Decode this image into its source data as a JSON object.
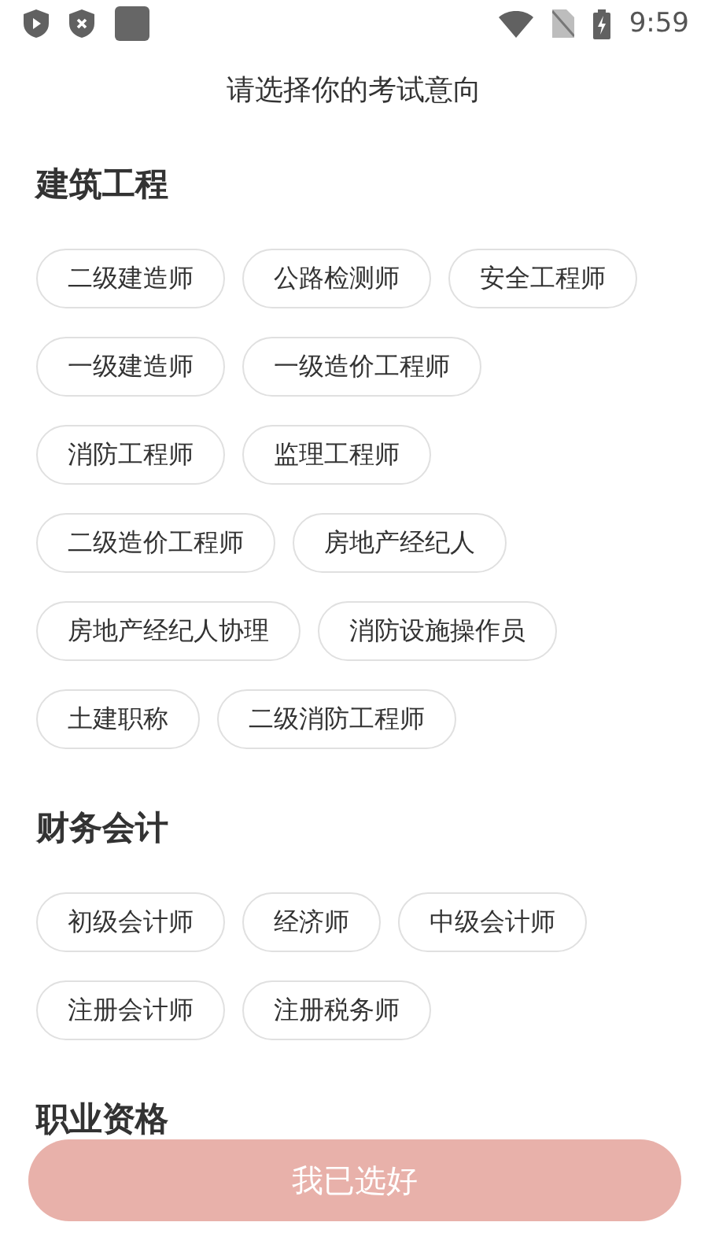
{
  "status_bar": {
    "time": "9:59"
  },
  "header": {
    "title": "请选择你的考试意向"
  },
  "sections": [
    {
      "title": "建筑工程",
      "options": [
        {
          "label": "二级建造师",
          "selected": false
        },
        {
          "label": "公路检测师",
          "selected": false
        },
        {
          "label": "安全工程师",
          "selected": false
        },
        {
          "label": "一级建造师",
          "selected": false
        },
        {
          "label": "一级造价工程师",
          "selected": false
        },
        {
          "label": "消防工程师",
          "selected": false
        },
        {
          "label": "监理工程师",
          "selected": false
        },
        {
          "label": "二级造价工程师",
          "selected": false
        },
        {
          "label": "房地产经纪人",
          "selected": false
        },
        {
          "label": "房地产经纪人协理",
          "selected": false
        },
        {
          "label": "消防设施操作员",
          "selected": false
        },
        {
          "label": "土建职称",
          "selected": false
        },
        {
          "label": "二级消防工程师",
          "selected": false
        }
      ]
    },
    {
      "title": "财务会计",
      "options": [
        {
          "label": "初级会计师",
          "selected": false
        },
        {
          "label": "经济师",
          "selected": false
        },
        {
          "label": "中级会计师",
          "selected": false
        },
        {
          "label": "注册会计师",
          "selected": false
        },
        {
          "label": "注册税务师",
          "selected": false
        }
      ]
    },
    {
      "title": "职业资格"
    }
  ],
  "confirm_button": {
    "label": "我已选好",
    "disabled": true
  }
}
